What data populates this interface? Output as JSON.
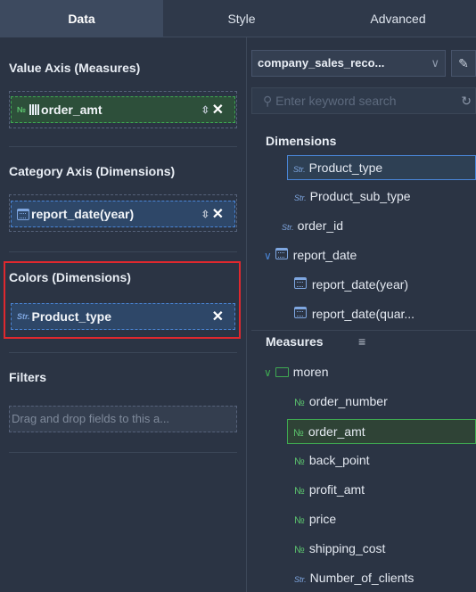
{
  "tabs": [
    "Data",
    "Style",
    "Advanced"
  ],
  "left": {
    "value_axis_title": "Value Axis (Measures)",
    "value_field": "order_amt",
    "category_axis_title": "Category Axis (Dimensions)",
    "category_field": "report_date(year)",
    "colors_title": "Colors (Dimensions)",
    "colors_field": "Product_type",
    "filters_title": "Filters",
    "filters_placeholder": "Drag and drop fields to this a..."
  },
  "right": {
    "dataset": "company_sales_reco...",
    "search_placeholder": "Enter keyword search",
    "dimensions_title": "Dimensions",
    "dimensions": [
      "Product_type",
      "Product_sub_type",
      "order_id",
      "report_date",
      "report_date(year)",
      "report_date(quar..."
    ],
    "measures_title": "Measures",
    "folder": "moren",
    "measures": [
      "order_number",
      "order_amt",
      "back_point",
      "profit_amt",
      "price",
      "shipping_cost",
      "Number_of_clients"
    ]
  },
  "icons": {
    "num_badge": "№",
    "str_badge": "Str.",
    "close": "✕",
    "sort": "⇳",
    "chevron": "∨",
    "edit": "✎",
    "refresh": "↻",
    "search": "⚲",
    "caret_down": "∨",
    "menu": "≡"
  },
  "colors": {
    "highlight": "#e0282e",
    "measure": "#3faa52",
    "dimension": "#4a86d8"
  }
}
